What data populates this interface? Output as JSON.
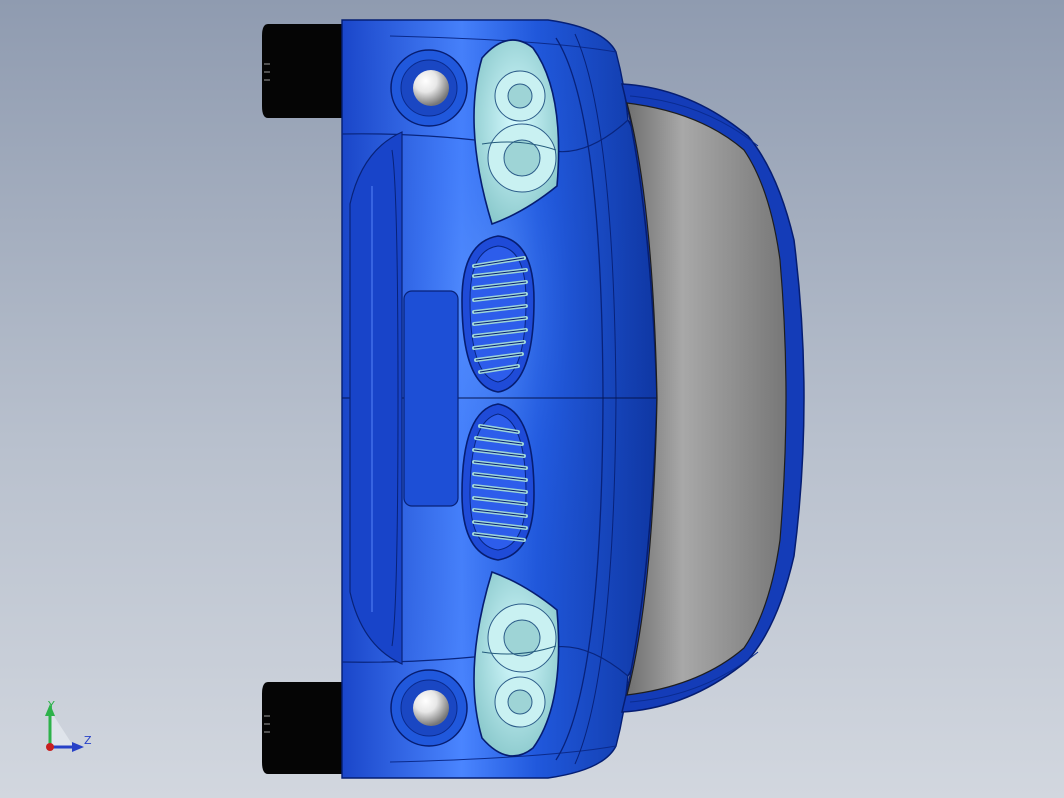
{
  "viewport": {
    "background_top": "#8f9bb0",
    "background_bottom": "#d2d7df",
    "model_color": "#1f4fd0",
    "glass_color": "#8f8f8f",
    "headlight_color": "#9fd6d8",
    "tire_color": "#050505"
  },
  "triad": {
    "y_label": "Y",
    "z_label": "Z",
    "y_color": "#2db24a",
    "z_color": "#2741c7",
    "origin_color": "#c81f1f"
  }
}
